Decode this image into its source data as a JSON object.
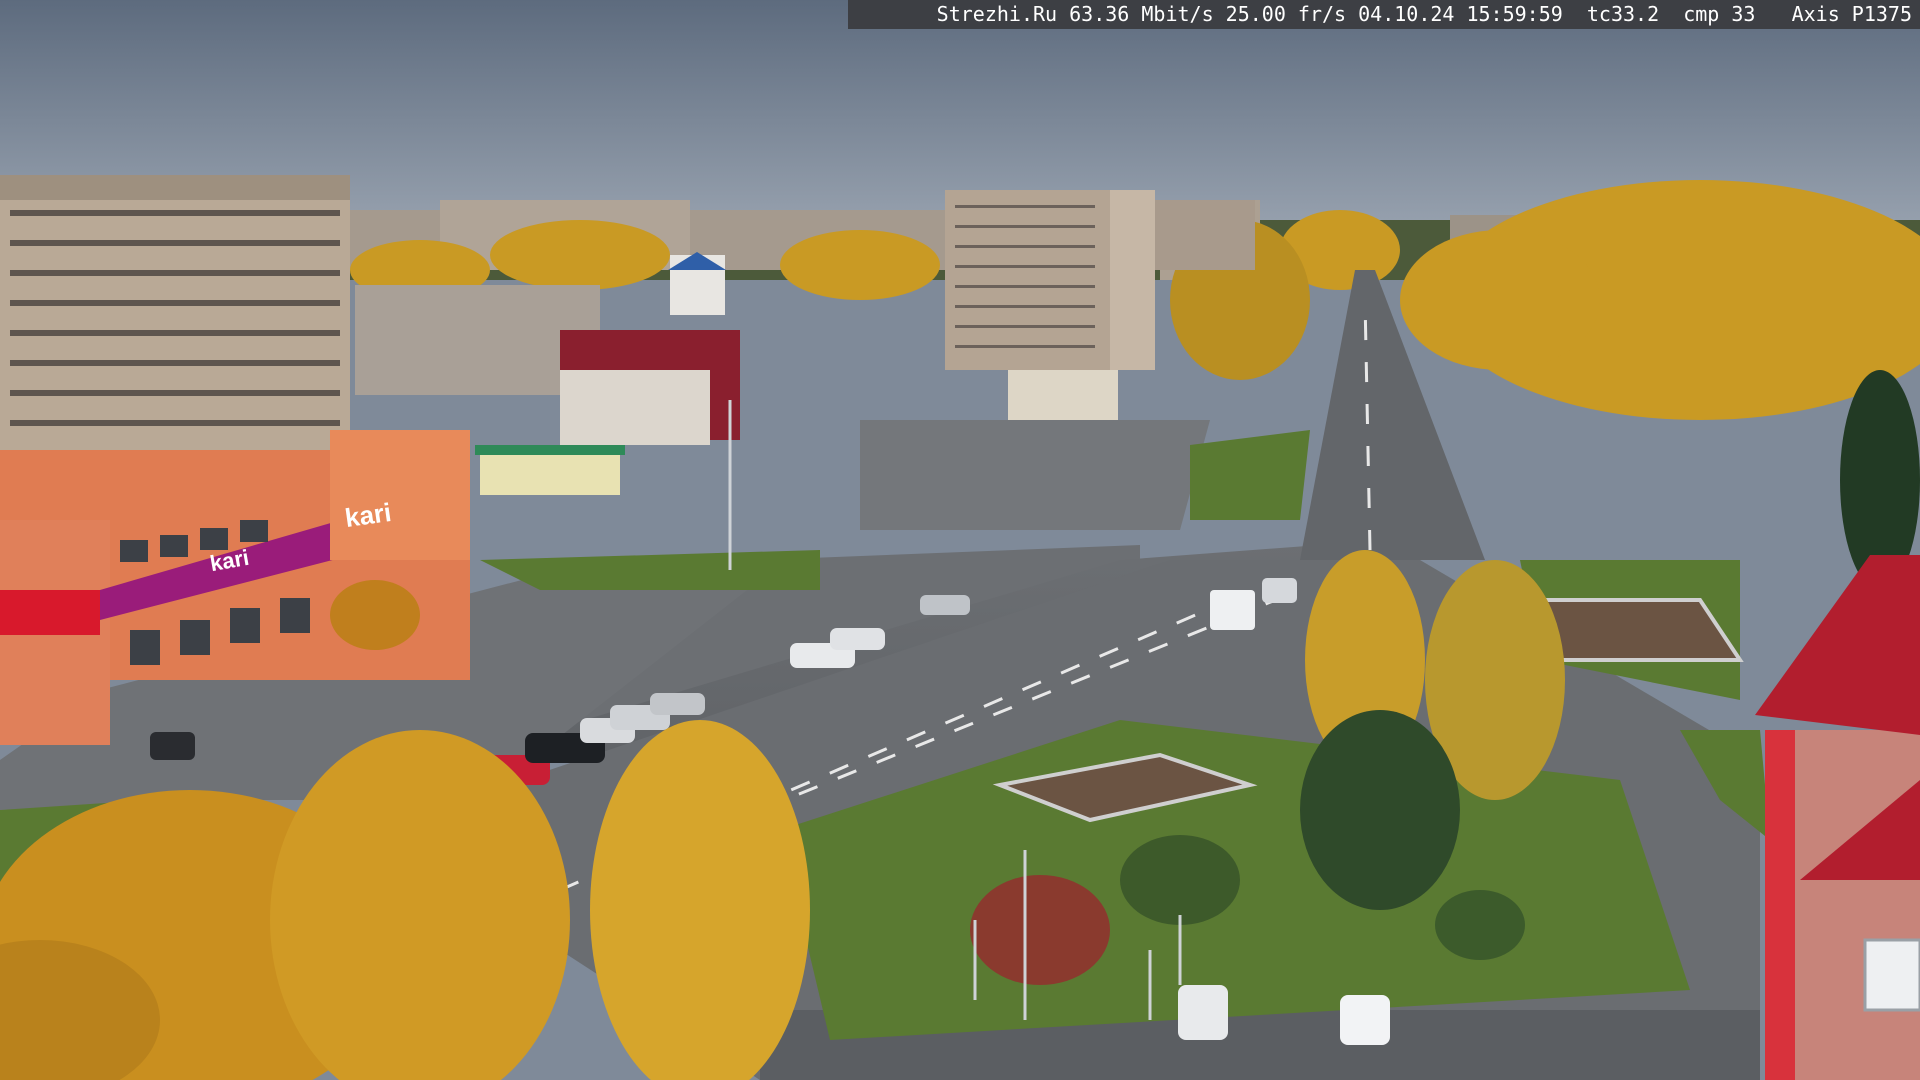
{
  "overlay": {
    "text": "Strezhi.Ru 63.36 Mbit/s 25.00 fr/s 04.10.24 15:59:59  tc33.2  cmp 33   Axis P1375"
  },
  "storefront": {
    "sign_main": "kari",
    "sign_side": "kari"
  },
  "colors": {
    "sky": "#7d8898",
    "asphalt": "#6e7175",
    "grass": "#5a7a32",
    "foliage_yellow": "#d9a82a",
    "building_panel": "#b9a996",
    "store_orange": "#e07c52",
    "store_magenta": "#9a1c7a",
    "roof_red": "#b21e2e"
  }
}
